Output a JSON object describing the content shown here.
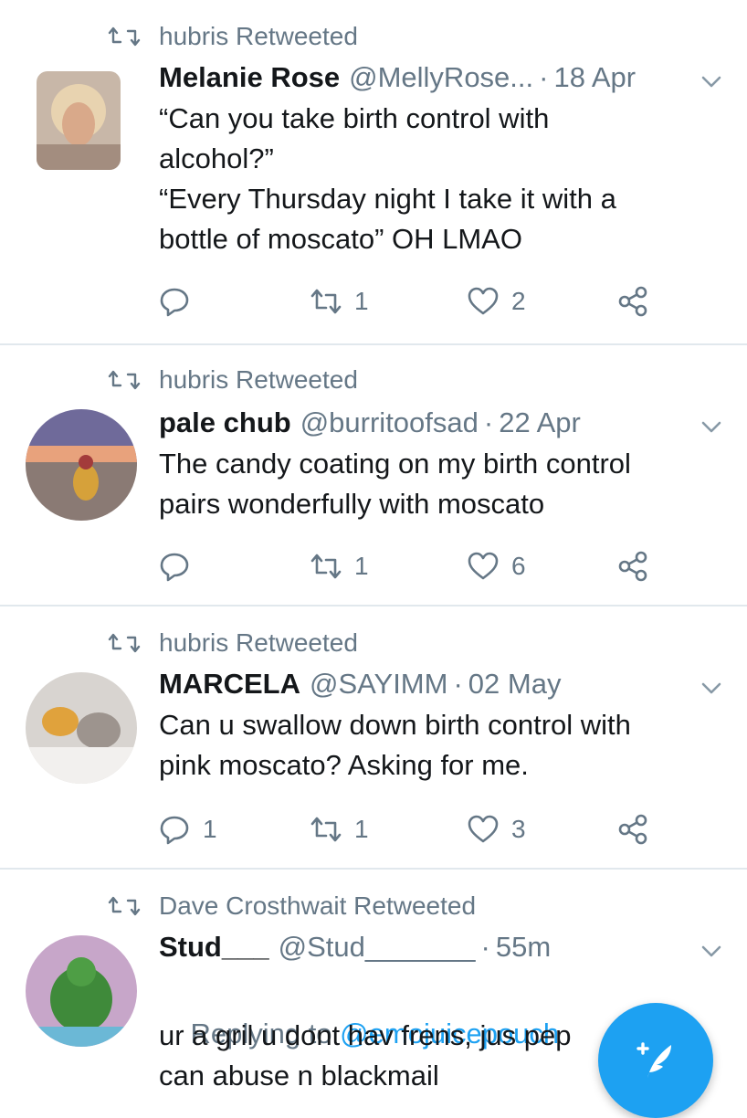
{
  "tweets": [
    {
      "retweeted_by": "hubris Retweeted",
      "name": "Melanie Rose",
      "handle": "@MellyRose...",
      "time": "18 Apr",
      "text": "“Can you take birth control with\nalcohol?”\n“Every Thursday night I take it with a\nbottle of moscato” OH LMAO",
      "replies": "",
      "retweets": "1",
      "likes": "2"
    },
    {
      "retweeted_by": "hubris Retweeted",
      "name": "pale chub",
      "handle": "@burritoofsad",
      "time": "22 Apr",
      "text": "The candy coating on my birth control\npairs wonderfully with moscato",
      "replies": "",
      "retweets": "1",
      "likes": "6"
    },
    {
      "retweeted_by": "hubris Retweeted",
      "name": "MARCELA",
      "handle": "@SAYIMM",
      "time": "02 May",
      "text": "Can u swallow down birth control with\npink moscato? Asking for me.",
      "replies": "1",
      "retweets": "1",
      "likes": "3"
    },
    {
      "retweeted_by": "Dave Crosthwait Retweeted",
      "name": "Stud___",
      "handle": "@Stud_______",
      "time": "55m",
      "replying_prefix": "Replying to ",
      "replying_mention": "@emojuicepouch",
      "text": "ur a gril u dont hav frens, jus pep          u\ncan abuse n blackmail"
    }
  ],
  "fab": {
    "icon": "compose-tweet-icon"
  },
  "colors": {
    "accent": "#1da1f2",
    "muted": "#657786",
    "text": "#14171a",
    "divider": "#e1e8ed"
  }
}
